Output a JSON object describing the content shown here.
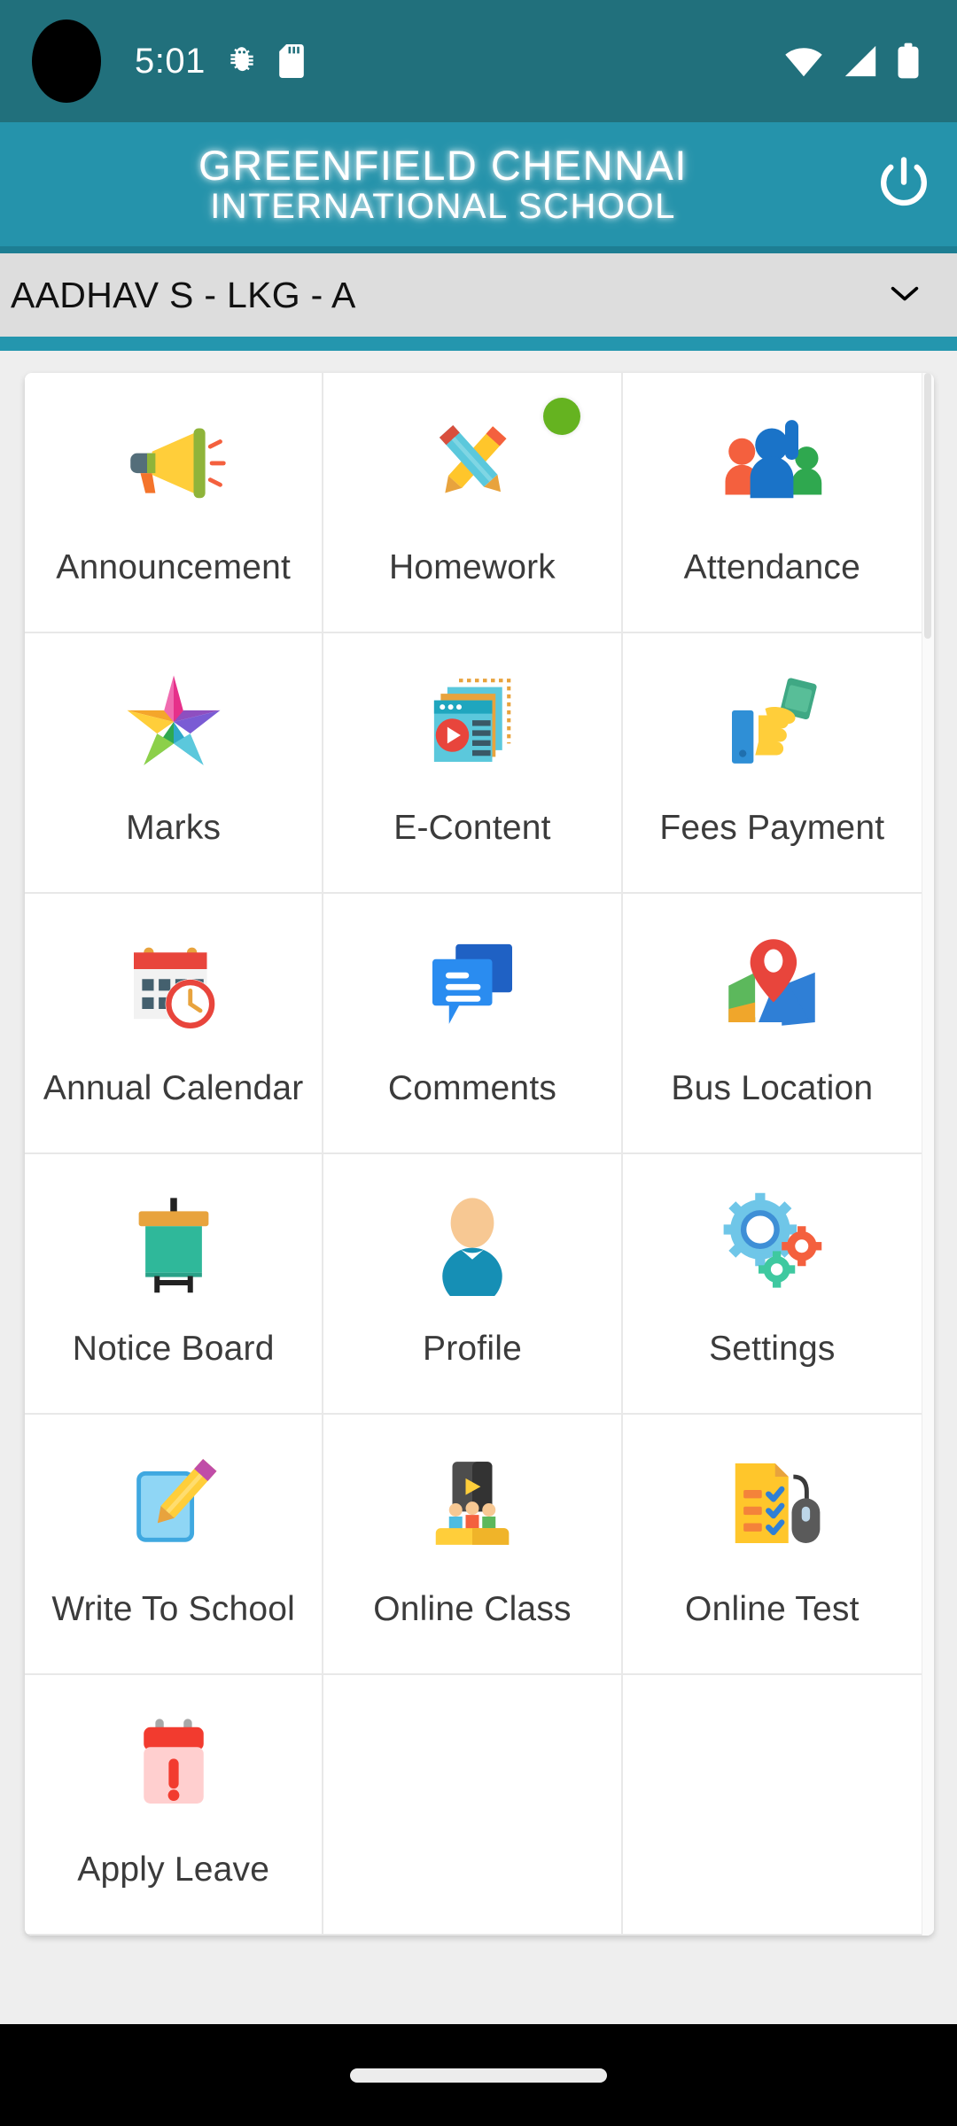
{
  "status_bar": {
    "time": "5:01",
    "icons": [
      "bug-debug-icon",
      "sd-card-icon"
    ],
    "right_icons": [
      "wifi-icon",
      "cellular-signal-icon",
      "battery-icon"
    ],
    "background_color": "#21707C"
  },
  "header": {
    "title_line1": "GREENFIELD CHENNAI",
    "title_line2": "INTERNATIONAL SCHOOL",
    "power_icon": "power-logout-icon",
    "background_color": "#2593AB"
  },
  "student_selector": {
    "value": "AADHAV S - LKG - A",
    "chevron": "chevron-down-icon",
    "background_color": "#DDDDDD",
    "underline_color": "#2496AE"
  },
  "grid": {
    "tiles": [
      {
        "label": "Announcement",
        "icon": "megaphone-icon",
        "badge": false
      },
      {
        "label": "Homework",
        "icon": "crossed-pencils-icon",
        "badge": true,
        "badge_color": "#65B320"
      },
      {
        "label": "Attendance",
        "icon": "people-raised-hand-icon",
        "badge": false
      },
      {
        "label": "Marks",
        "icon": "colorful-star-icon",
        "badge": false
      },
      {
        "label": "E-Content",
        "icon": "media-pages-icon",
        "badge": false
      },
      {
        "label": "Fees Payment",
        "icon": "hand-cash-icon",
        "badge": false
      },
      {
        "label": "Annual Calendar",
        "icon": "calendar-clock-icon",
        "badge": false
      },
      {
        "label": "Comments",
        "icon": "chat-bubbles-icon",
        "badge": false
      },
      {
        "label": "Bus Location",
        "icon": "map-pin-icon",
        "badge": false
      },
      {
        "label": "Notice Board",
        "icon": "easel-board-icon",
        "badge": false
      },
      {
        "label": "Profile",
        "icon": "user-avatar-icon",
        "badge": false
      },
      {
        "label": "Settings",
        "icon": "gears-icon",
        "badge": false
      },
      {
        "label": "Write To School",
        "icon": "note-pencil-icon",
        "badge": false
      },
      {
        "label": "Online Class",
        "icon": "screen-students-icon",
        "badge": false
      },
      {
        "label": "Online Test",
        "icon": "checklist-mouse-icon",
        "badge": false
      },
      {
        "label": "Apply Leave",
        "icon": "red-calendar-alert-icon",
        "badge": false
      },
      {
        "label": "",
        "icon": "",
        "badge": false
      },
      {
        "label": "",
        "icon": "",
        "badge": false
      }
    ]
  },
  "navigation_bar": {
    "gesture_pill": "home-gesture-pill",
    "background_color": "#000000"
  }
}
